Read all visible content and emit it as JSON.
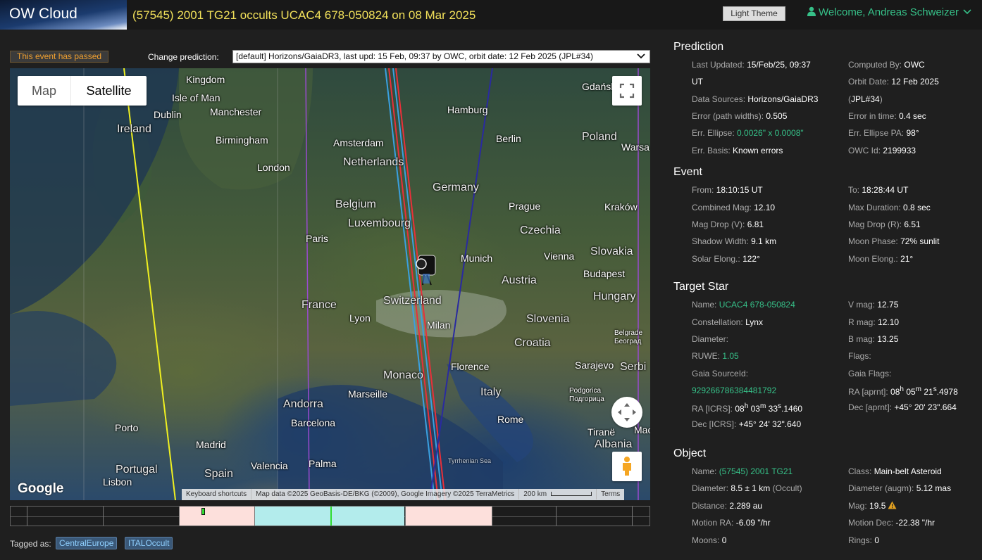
{
  "header": {
    "logo_text": "OW Cloud",
    "event_title": "(57545) 2001 TG21 occults UCAC4 678-050824 on 08 Mar 2025",
    "theme_button": "Light Theme",
    "welcome": "Welcome, Andreas Schweizer"
  },
  "controls": {
    "passed_badge": "This event has passed",
    "change_prediction_label": "Change prediction:",
    "prediction_selected": "[default] Horizons/GaiaDR3, last upd: 15 Feb, 09:37 by OWC, orbit date: 12 Feb 2025 (JPL#34)"
  },
  "map": {
    "type_map": "Map",
    "type_satellite": "Satellite",
    "google": "Google",
    "attribution": {
      "shortcuts": "Keyboard shortcuts",
      "data": "Map data ©2025 GeoBasis-DE/BKG (©2009), Google Imagery ©2025 TerraMetrics",
      "scale": "200 km",
      "terms": "Terms"
    },
    "labels": {
      "kingdom": "Kingdom",
      "isle_of_man": "Isle of Man",
      "dublin": "Dublin",
      "ireland": "Ireland",
      "manchester": "Manchester",
      "birmingham": "Birmingham",
      "london": "London",
      "amsterdam": "Amsterdam",
      "netherlands": "Netherlands",
      "hamburg": "Hamburg",
      "berlin": "Berlin",
      "gdansk": "Gdańsk",
      "poland": "Poland",
      "warsaw": "Warsa",
      "germany": "Germany",
      "belgium": "Belgium",
      "luxembourg": "Luxembourg",
      "prague": "Prague",
      "krakow": "Kraków",
      "czechia": "Czechia",
      "paris": "Paris",
      "munich": "Munich",
      "vienna": "Vienna",
      "slovakia": "Slovakia",
      "budapest": "Budapest",
      "austria": "Austria",
      "hungary": "Hungary",
      "france": "France",
      "switzerland": "Switzerland",
      "lyon": "Lyon",
      "milan": "Milan",
      "slovenia": "Slovenia",
      "croatia": "Croatia",
      "belgrade": "Belgrade\nБеоград",
      "sarajevo": "Sarajevo",
      "serbia": "Serbi",
      "florence": "Florence",
      "monaco": "Monaco",
      "marseille": "Marseille",
      "italy": "Italy",
      "podgorica": "Podgorica\nПодгорица",
      "andorra": "Andorra",
      "barcelona": "Barcelona",
      "rome": "Rome",
      "tirane": "Tiranë",
      "albania": "Albania",
      "porto": "Porto",
      "madrid": "Madrid",
      "portugal": "Portugal",
      "spain": "Spain",
      "valencia": "Valencia",
      "palma": "Palma",
      "lisbon": "Lisbon",
      "tyrrhenian": "Tyrrhenian Sea",
      "mace": "Mace"
    }
  },
  "timeline": {
    "segments": [
      {
        "start": 0.263,
        "end": 0.382,
        "color": "#fde0dc"
      },
      {
        "start": 0.382,
        "end": 0.617,
        "color": "#b3ecec"
      },
      {
        "start": 0.617,
        "end": 0.753,
        "color": "#fde0dc"
      }
    ],
    "ticks": [
      0.025,
      0.144,
      0.263,
      0.382,
      0.501,
      0.617,
      0.753,
      0.853,
      0.972
    ],
    "markers": [
      {
        "pos": 0.299,
        "color": "#2fdc2f"
      },
      {
        "pos": 0.501,
        "color": "#2fdc2f"
      }
    ]
  },
  "tags": {
    "label": "Tagged as:",
    "items": [
      "CentralEurope",
      "ITALOccult"
    ]
  },
  "prediction": {
    "heading": "Prediction",
    "last_updated_label": "Last Updated:",
    "last_updated_value": "15/Feb/25, 09:37",
    "last_updated_value2": "UT",
    "computed_by_label": "Computed By:",
    "computed_by_value": "OWC",
    "orbit_date_label": "Orbit Date:",
    "orbit_date_value": "12 Feb 2025",
    "orbit_date_value2_open": "(",
    "orbit_date_value2": "JPL#34",
    "orbit_date_value2_close": ")",
    "data_sources_label": "Data Sources:",
    "data_sources_value": "Horizons/GaiaDR3",
    "error_path_label": "Error (path widths):",
    "error_path_value": "0.505",
    "error_time_label": "Error in time:",
    "error_time_value": "0.4 sec",
    "err_ellipse_label": "Err. Ellipse:",
    "err_ellipse_value": "0.0026\" x 0.0008\"",
    "err_ellipse_pa_label": "Err. Ellipse PA:",
    "err_ellipse_pa_value": "98°",
    "err_basis_label": "Err. Basis:",
    "err_basis_value": "Known errors",
    "owc_id_label": "OWC Id:",
    "owc_id_value": "2199933"
  },
  "event": {
    "heading": "Event",
    "from_label": "From:",
    "from_value": "18:10:15 UT",
    "to_label": "To:",
    "to_value": "18:28:44 UT",
    "combined_mag_label": "Combined Mag:",
    "combined_mag_value": "12.10",
    "max_duration_label": "Max Duration:",
    "max_duration_value": "0.8 sec",
    "mag_drop_v_label": "Mag Drop (V):",
    "mag_drop_v_value": "6.81",
    "mag_drop_r_label": "Mag Drop (R):",
    "mag_drop_r_value": "6.51",
    "shadow_width_label": "Shadow Width:",
    "shadow_width_value": "9.1 km",
    "moon_phase_label": "Moon Phase:",
    "moon_phase_value": "72% sunlit",
    "solar_elong_label": "Solar Elong.:",
    "solar_elong_value": "122°",
    "moon_elong_label": "Moon Elong.:",
    "moon_elong_value": "21°"
  },
  "target_star": {
    "heading": "Target Star",
    "name_label": "Name:",
    "name_value": "UCAC4 678-050824",
    "vmag_label": "V mag:",
    "vmag_value": "12.75",
    "constellation_label": "Constellation:",
    "constellation_value": "Lynx",
    "rmag_label": "R mag:",
    "rmag_value": "12.10",
    "diameter_label": "Diameter:",
    "bmag_label": "B mag:",
    "bmag_value": "13.25",
    "ruwe_label": "RUWE:",
    "ruwe_value": "1.05",
    "flags_label": "Flags:",
    "gaia_source_label": "Gaia SourceId:",
    "gaia_source_value": "929266786384481792",
    "gaia_flags_label": "Gaia Flags:",
    "ra_icrs_label": "RA [ICRS]:",
    "ra_icrs_h": "08",
    "ra_icrs_m": "03",
    "ra_icrs_s": "33",
    "ra_icrs_frac": ".1460",
    "ra_aprnt_label": "RA [aprnt]:",
    "ra_aprnt_h": "08",
    "ra_aprnt_m": "05",
    "ra_aprnt_s": "21",
    "ra_aprnt_frac": ".4978",
    "dec_icrs_label": "Dec [ICRS]:",
    "dec_icrs_value": "+45° 24' 32\".640",
    "dec_aprnt_label": "Dec [aprnt]:",
    "dec_aprnt_value": "+45° 20' 23\".664",
    "unit_h": "h",
    "unit_m": "m",
    "unit_s": "s"
  },
  "object": {
    "heading": "Object",
    "name_label": "Name:",
    "name_value": "(57545) 2001 TG21",
    "class_label": "Class:",
    "class_value": "Main-belt Asteroid",
    "diameter_label": "Diameter:",
    "diameter_value": "8.5 ± 1 km",
    "diameter_note": "(Occult)",
    "diameter_augm_label": "Diameter (augm):",
    "diameter_augm_value": "5.12 mas",
    "distance_label": "Distance:",
    "distance_value": "2.289 au",
    "mag_label": "Mag:",
    "mag_value": "19.5",
    "motion_ra_label": "Motion RA:",
    "motion_ra_value": "-6.09 \"/hr",
    "motion_dec_label": "Motion Dec:",
    "motion_dec_value": "-22.38 \"/hr",
    "moons_label": "Moons:",
    "moons_value": "0",
    "rings_label": "Rings:",
    "rings_value": "0"
  },
  "colors": {
    "accent_green": "#36c088",
    "title_yellow": "#f1e05a",
    "passed_orange": "#f0a030",
    "path_center": "#e8303a",
    "path_limit": "#3aa0e0",
    "path_error": "#2a2aa0",
    "path_purple": "#9a4ad0",
    "path_yellow": "#f0f020"
  }
}
